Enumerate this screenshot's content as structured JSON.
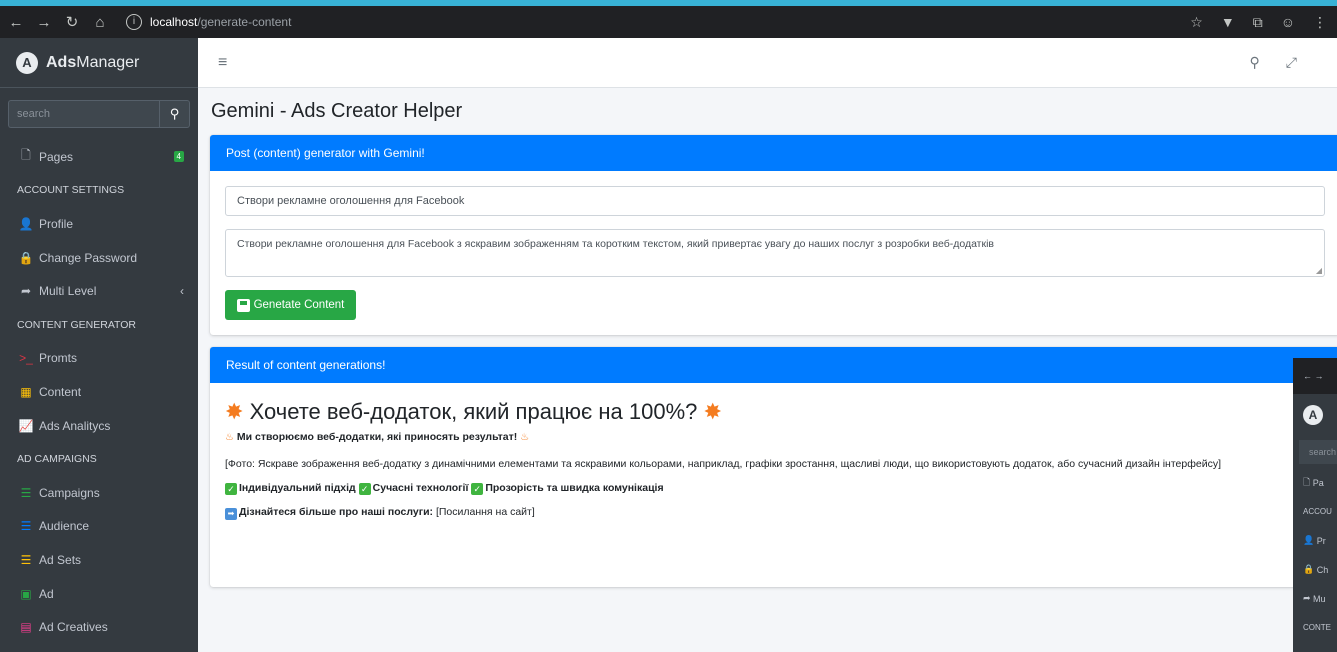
{
  "browser": {
    "url_host": "localhost",
    "url_path": "/generate-content"
  },
  "brand": {
    "logo_letter": "A",
    "name_bold": "Ads",
    "name_rest": "Manager"
  },
  "sidebar": {
    "search_placeholder": "search",
    "pages": {
      "label": "Pages",
      "badge": "4"
    },
    "section_account": "ACCOUNT SETTINGS",
    "profile": "Profile",
    "change_password": "Change Password",
    "multi_level": "Multi Level",
    "section_content": "CONTENT GENERATOR",
    "promts": "Promts",
    "content": "Content",
    "ads_analytics": "Ads Analitycs",
    "section_campaigns": "AD CAMPAIGNS",
    "campaigns": "Campaigns",
    "audience": "Audience",
    "ad_sets": "Ad Sets",
    "ad": "Ad",
    "ad_creatives": "Ad Creatives",
    "colors": {
      "promts": "#dc3545",
      "content": "#ffc107",
      "analytics": "#17a2b8",
      "campaigns": "#28a745",
      "audience": "#007bff",
      "ad_sets": "#ffc107",
      "ad": "#28a745",
      "ad_creatives": "#e83e8c"
    }
  },
  "page": {
    "title": "Gemini - Ads Creator Helper"
  },
  "generator": {
    "header": "Post (content) generator with Gemini!",
    "input_value": "Створи рекламне оголошення для Facebook",
    "textarea_value": "Створи рекламне оголошення для Facebook з яскравим зображенням та коротким текстом, який привертає увагу до наших послуг з розробки веб-додатків",
    "button_label": "Genetate Content"
  },
  "result": {
    "header": "Result of content generations!",
    "headline": "Хочете веб-додаток, який працює на 100%?",
    "subhead": "Ми створюємо веб-додатки, які приносять результат!",
    "photo_text": "[Фото: Яскраве зображення веб-додатку з динамічними елементами та яскравими кольорами, наприклад, графіки зростання, щасливі люди, що використовують додаток, або сучасний дизайн інтерфейсу]",
    "feature_1": "Індивідуальний підхід",
    "feature_2": "Сучасні технології",
    "feature_3": "Прозорість та швидка комунікація",
    "cta_bold": "Дізнайтеся більше про наші послуги:",
    "cta_link": "[Посилання на сайт]"
  },
  "mini_window": {
    "search": "search",
    "pages": "Pa",
    "account": "ACCOU",
    "profile": "Pr",
    "change": "Ch",
    "multi": "Mu",
    "content": "CONTE"
  }
}
